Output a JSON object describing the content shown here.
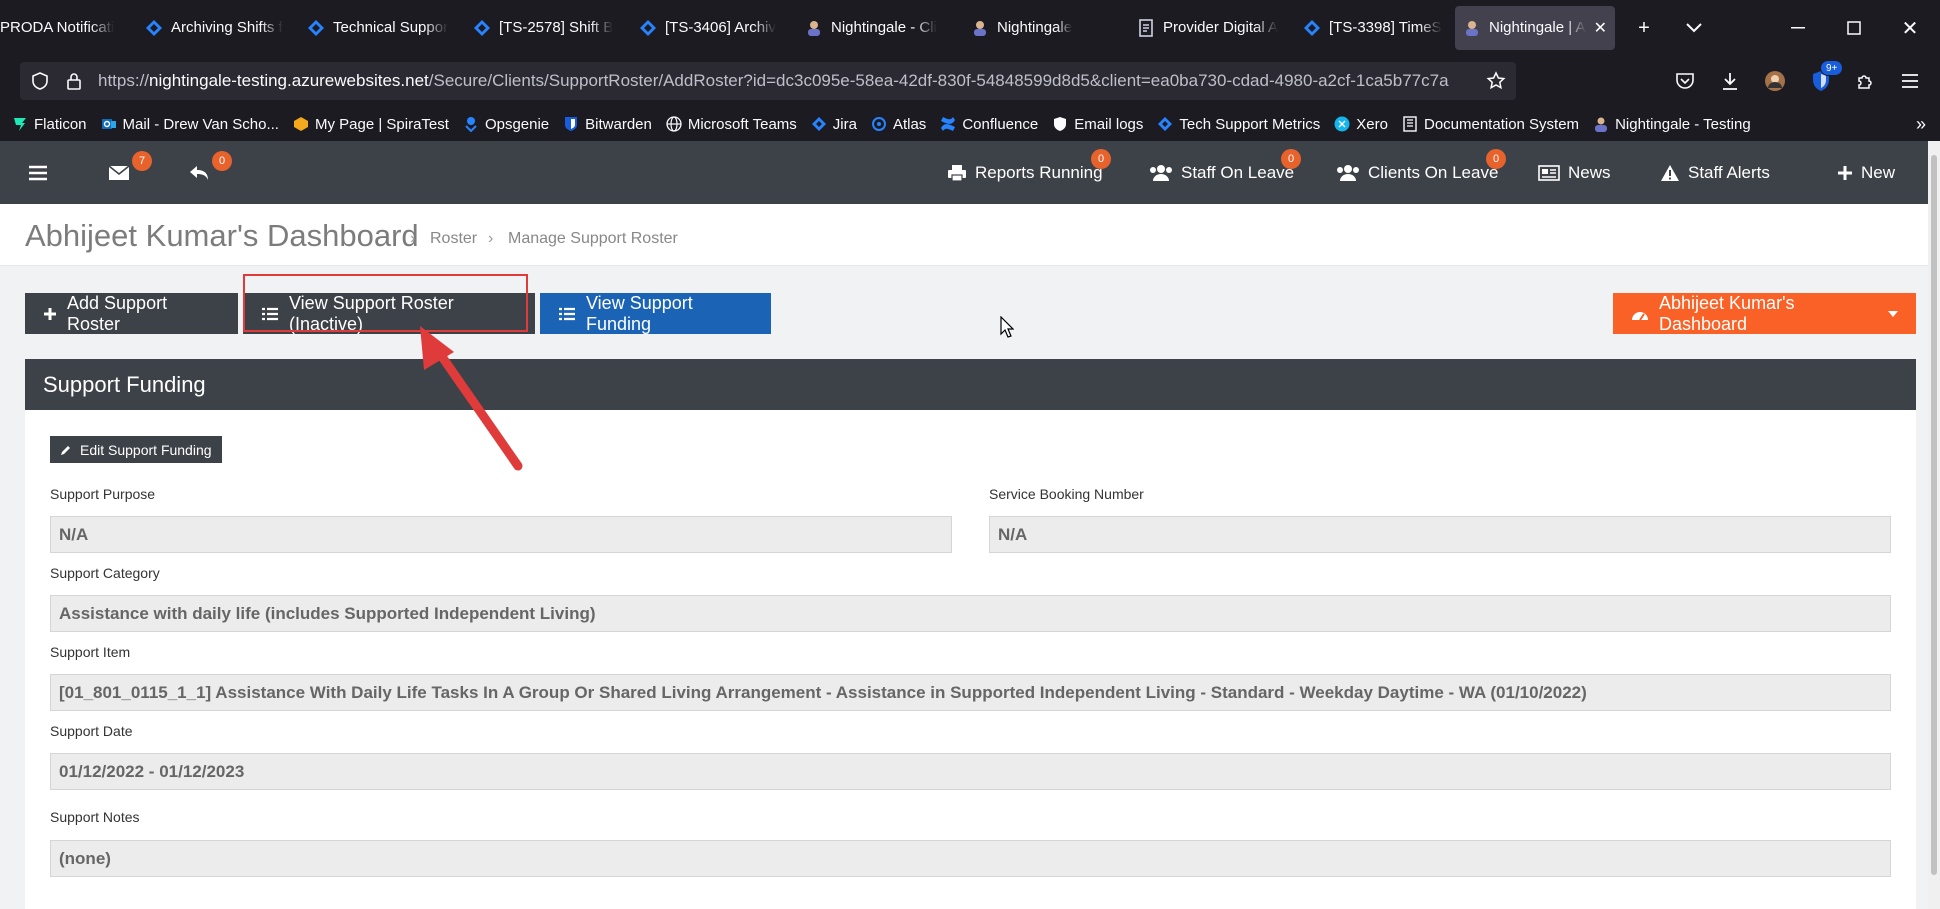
{
  "browser": {
    "tabs": [
      {
        "label": "PRODA Notificati",
        "icon": "proda-icon"
      },
      {
        "label": "Archiving Shifts f",
        "icon": "jira-icon"
      },
      {
        "label": "Technical Suppor",
        "icon": "jira-icon"
      },
      {
        "label": "[TS-2578] Shift B",
        "icon": "jira-icon"
      },
      {
        "label": "[TS-3406] Archiv",
        "icon": "jira-icon"
      },
      {
        "label": "Nightingale - Cli",
        "icon": "nightingale-icon"
      },
      {
        "label": "Nightingale",
        "icon": "nightingale-icon"
      },
      {
        "label": "Provider Digital A",
        "icon": "document-icon"
      },
      {
        "label": "[TS-3398] TimeS",
        "icon": "jira-icon"
      },
      {
        "label": "Nightingale | A",
        "icon": "nightingale-icon",
        "active": true
      }
    ],
    "url_prefix": "https://",
    "url_host": "nightingale-testing.azurewebsites.net",
    "url_path": "/Secure/Clients/SupportRoster/AddRoster?id=dc3c095e-58ea-42df-830f-54848599d8d5&client=ea0ba730-cdad-4980-a2cf-1ca5b77c7a",
    "extension_badge": "9+",
    "bookmarks": [
      {
        "label": "Flaticon",
        "icon": "flaticon-icon"
      },
      {
        "label": "Mail - Drew Van Scho...",
        "icon": "outlook-icon"
      },
      {
        "label": "My Page | SpiraTest",
        "icon": "spiratest-icon"
      },
      {
        "label": "Opsgenie",
        "icon": "opsgenie-icon"
      },
      {
        "label": "Bitwarden",
        "icon": "bitwarden-icon"
      },
      {
        "label": "Microsoft Teams",
        "icon": "globe-icon"
      },
      {
        "label": "Jira",
        "icon": "jira-icon"
      },
      {
        "label": "Atlas",
        "icon": "atlas-icon"
      },
      {
        "label": "Confluence",
        "icon": "confluence-icon"
      },
      {
        "label": "Email logs",
        "icon": "shield-icon"
      },
      {
        "label": "Tech Support Metrics",
        "icon": "jira-icon"
      },
      {
        "label": "Xero",
        "icon": "xero-icon"
      },
      {
        "label": "Documentation System",
        "icon": "book-icon"
      },
      {
        "label": "Nightingale - Testing",
        "icon": "nightingale-icon"
      }
    ]
  },
  "appnav": {
    "mail_count": "7",
    "reply_count": "0",
    "items": [
      {
        "label": "Reports Running",
        "badge": "0"
      },
      {
        "label": "Staff On Leave",
        "badge": "0"
      },
      {
        "label": "Clients On Leave",
        "badge": "0"
      },
      {
        "label": "News"
      },
      {
        "label": "Staff Alerts"
      },
      {
        "label": "New"
      }
    ]
  },
  "header": {
    "title": "Abhijeet Kumar's Dashboard",
    "breadcrumb": [
      "Roster",
      "Manage Support Roster"
    ]
  },
  "toolbar": {
    "add_label": "Add Support Roster",
    "view_inactive_label": "View Support Roster (Inactive)",
    "view_funding_label": "View Support Funding",
    "dashboard_label": "Abhijeet Kumar's Dashboard"
  },
  "panel": {
    "title": "Support Funding",
    "edit_label": "Edit Support Funding",
    "fields": {
      "purpose": {
        "label": "Support Purpose",
        "value": "N/A"
      },
      "booking": {
        "label": "Service Booking Number",
        "value": "N/A"
      },
      "category": {
        "label": "Support Category",
        "value": "Assistance with daily life (includes Supported Independent Living)"
      },
      "item": {
        "label": "Support Item",
        "value": "[01_801_0115_1_1] Assistance With Daily Life Tasks In A Group Or Shared Living Arrangement - Assistance in Supported Independent Living - Standard - Weekday Daytime - WA (01/10/2022)"
      },
      "date": {
        "label": "Support Date",
        "value": "01/12/2022 - 01/12/2023"
      },
      "notes": {
        "label": "Support Notes",
        "value": "(none)"
      }
    }
  },
  "colors": {
    "nav_bg": "#3d4148",
    "blue_button": "#1b64b5",
    "orange_button": "#f96126",
    "badge": "#e8622c",
    "annotation": "#e03b3b"
  }
}
